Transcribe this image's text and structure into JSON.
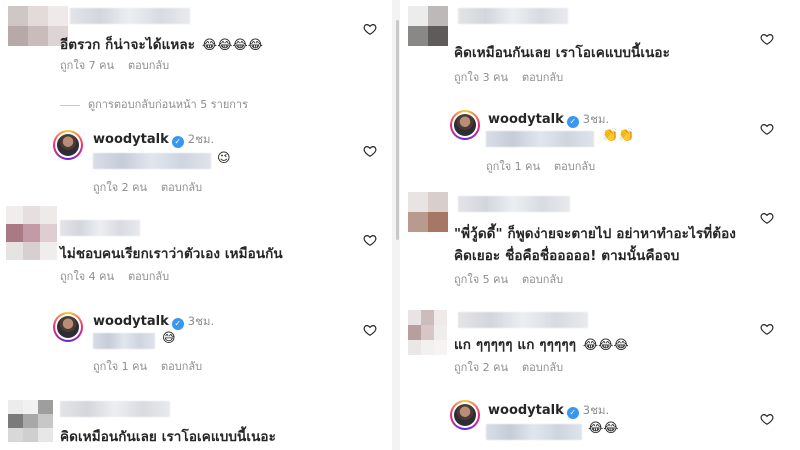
{
  "common": {
    "like_label_prefix": "ถูกใจ",
    "like_label_suffix": "คน",
    "reply_label": "ตอบกลับ"
  },
  "left": {
    "c1": {
      "text": "อีตรวก ก็น่าจะได้แหละ",
      "emoji": "😂😂😂😂",
      "likes": "ถูกใจ 7 คน",
      "reply": "ตอบกลับ"
    },
    "view_replies": "ดูการตอบกลับก่อนหน้า 5 รายการ",
    "r1": {
      "username": "woodytalk",
      "time": "2ชม.",
      "emoji": "😉",
      "likes": "ถูกใจ 2 คน",
      "reply": "ตอบกลับ"
    },
    "c2": {
      "text": "ไม่ชอบคนเรียกเราว่าตัวเอง เหมือนกัน",
      "likes": "ถูกใจ 4 คน",
      "reply": "ตอบกลับ"
    },
    "r2": {
      "username": "woodytalk",
      "time": "3ชม.",
      "emoji": "😅",
      "likes": "ถูกใจ 1 คน",
      "reply": "ตอบกลับ"
    },
    "c3": {
      "text": "คิดเหมือนกันเลย เราโอเคแบบนี้เนอะ"
    }
  },
  "right": {
    "c1": {
      "text": "คิดเหมือนกันเลย เราโอเคแบบนี้เนอะ",
      "likes": "ถูกใจ 3 คน",
      "reply": "ตอบกลับ"
    },
    "r1": {
      "username": "woodytalk",
      "time": "3ชม.",
      "emoji": "👏👏",
      "likes": "ถูกใจ 1 คน",
      "reply": "ตอบกลับ"
    },
    "c2": {
      "line1": "\"พี่วู้ดดี้\" ก็พูดง่ายจะตายไป อย่าหาทำอะไรที่ต้อง",
      "line2": "คิดเยอะ ชื่อคือชื่อออออ! ตามนั้นคือจบ",
      "likes": "ถูกใจ 5 คน",
      "reply": "ตอบกลับ"
    },
    "c3": {
      "text": "แก ๆๆๆๆๆ แก ๆๆๆๆๆ",
      "emoji": "😂😂😂",
      "likes": "ถูกใจ 2 คน",
      "reply": "ตอบกลับ"
    },
    "r2": {
      "username": "woodytalk",
      "time": "3ชม.",
      "emoji": "😂😂"
    }
  },
  "icons": {
    "heart": "heart-outline-icon",
    "verified": "verified-badge-icon"
  },
  "colors": {
    "text": "#262626",
    "muted": "#8e8e8e",
    "verified": "#3897f0"
  }
}
